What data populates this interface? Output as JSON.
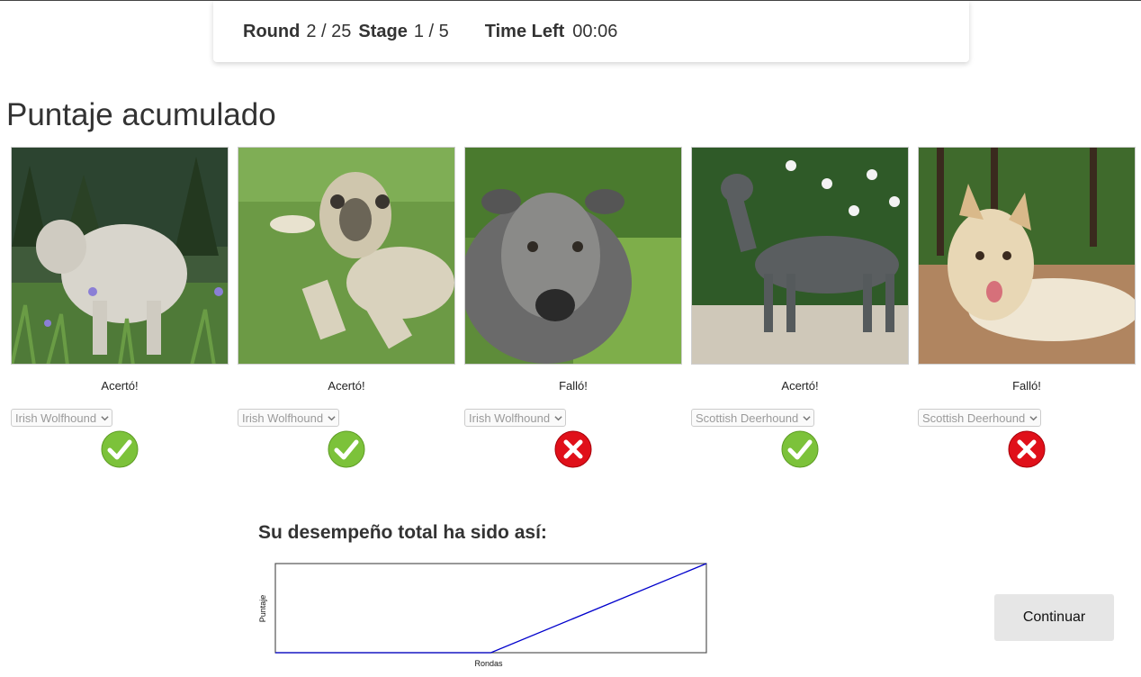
{
  "status": {
    "round_label": "Round",
    "round_value": "2 / 25",
    "stage_label": "Stage",
    "stage_value": "1 / 5",
    "time_label": "Time Left",
    "time_value": "00:06"
  },
  "heading": "Puntaje acumulado",
  "cards": [
    {
      "verdict": "Acertó!",
      "selected_breed": "Irish Wolfhound",
      "correct": true,
      "icon": "check-circle-icon"
    },
    {
      "verdict": "Acertó!",
      "selected_breed": "Irish Wolfhound",
      "correct": true,
      "icon": "check-circle-icon"
    },
    {
      "verdict": "Falló!",
      "selected_breed": "Irish Wolfhound",
      "correct": false,
      "icon": "x-circle-icon"
    },
    {
      "verdict": "Acertó!",
      "selected_breed": "Scottish Deerhound",
      "correct": true,
      "icon": "check-circle-icon"
    },
    {
      "verdict": "Falló!",
      "selected_breed": "Scottish Deerhound",
      "correct": false,
      "icon": "x-circle-icon"
    }
  ],
  "performance": {
    "title": "Su desempeño total ha sido así:"
  },
  "chart_data": {
    "type": "line",
    "title": "",
    "xlabel": "Rondas",
    "ylabel": "Puntaje",
    "x": [
      0,
      1,
      2
    ],
    "series": [
      {
        "values": [
          0,
          0,
          1
        ]
      }
    ],
    "xlim": [
      0,
      2
    ],
    "ylim": [
      0,
      1
    ],
    "grid": false,
    "line_color": "#0000cc"
  },
  "continue_label": "Continuar",
  "colors": {
    "correct": "#7cc23a",
    "wrong": "#e0101a",
    "button_bg": "#e6e6e6"
  }
}
